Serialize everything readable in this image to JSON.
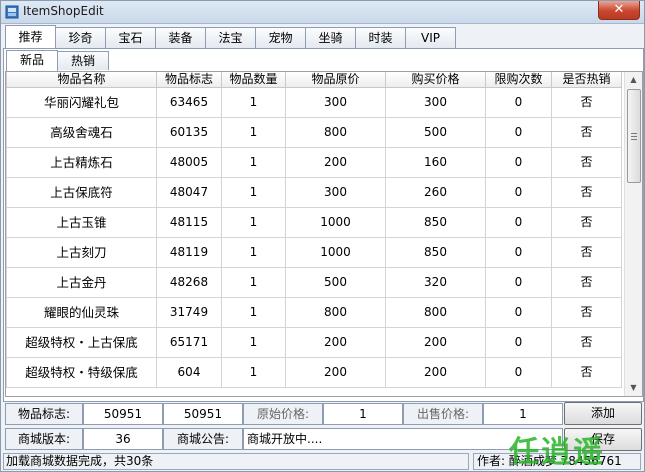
{
  "window": {
    "title": "ItemShopEdit",
    "close": "✕"
  },
  "tabs": [
    "推荐",
    "珍奇",
    "宝石",
    "装备",
    "法宝",
    "宠物",
    "坐骑",
    "时装",
    "VIP"
  ],
  "subtabs": [
    "新品",
    "热销"
  ],
  "table": {
    "columns": [
      "物品名称",
      "物品标志",
      "物品数量",
      "物品原价",
      "购买价格",
      "限购次数",
      "是否热销"
    ],
    "rows": [
      [
        "华丽闪耀礼包",
        "63465",
        "1",
        "300",
        "300",
        "0",
        "否"
      ],
      [
        "高级舍魂石",
        "60135",
        "1",
        "800",
        "500",
        "0",
        "否"
      ],
      [
        "上古精炼石",
        "48005",
        "1",
        "200",
        "160",
        "0",
        "否"
      ],
      [
        "上古保底符",
        "48047",
        "1",
        "300",
        "260",
        "0",
        "否"
      ],
      [
        "上古玉锥",
        "48115",
        "1",
        "1000",
        "850",
        "0",
        "否"
      ],
      [
        "上古刻刀",
        "48119",
        "1",
        "1000",
        "850",
        "0",
        "否"
      ],
      [
        "上古金丹",
        "48268",
        "1",
        "500",
        "320",
        "0",
        "否"
      ],
      [
        "耀眼的仙灵珠",
        "31749",
        "1",
        "800",
        "800",
        "0",
        "否"
      ],
      [
        "超级特权・上古保底",
        "65171",
        "1",
        "200",
        "200",
        "0",
        "否"
      ],
      [
        "超级特权・特级保底",
        "604",
        "1",
        "200",
        "200",
        "0",
        "否"
      ]
    ]
  },
  "form": {
    "item_id_label": "物品标志:",
    "item_id_value1": "50951",
    "item_id_value2": "50951",
    "orig_price_label": "原始价格:",
    "orig_price_value": "1",
    "sell_price_label": "出售价格:",
    "sell_price_value": "1",
    "add_button": "添加",
    "version_label": "商城版本:",
    "version_value": "36",
    "notice_label": "商城公告:",
    "notice_value": "商城开放中....",
    "save_button": "保存"
  },
  "status": {
    "left": "加载商城数据完成，共30条",
    "right": "作者: 醉酒成梦 78456761"
  },
  "watermark": "任逍遥"
}
